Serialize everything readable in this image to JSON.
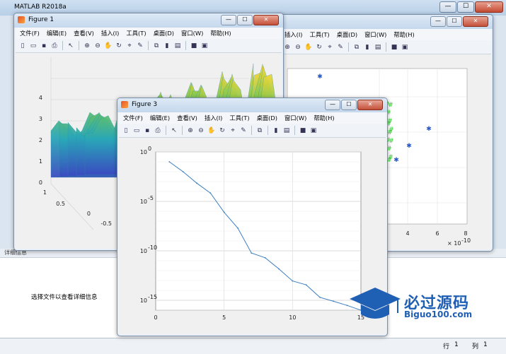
{
  "main_window": {
    "title": "MATLAB R2018a",
    "min": "—",
    "max": "☐",
    "close": "✕",
    "details_label": "详细信息",
    "details_message": "选择文件以查看详细信息",
    "status_row_label": "行",
    "status_row": "1",
    "status_col_label": "列",
    "status_col": "1"
  },
  "menu": [
    "文件(F)",
    "编辑(E)",
    "查看(V)",
    "插入(I)",
    "工具(T)",
    "桌面(D)",
    "窗口(W)",
    "帮助(H)"
  ],
  "figure1": {
    "title": "Figure 1",
    "z_ticks": [
      "4",
      "3",
      "2",
      "1",
      "0"
    ],
    "y_ticks": [
      "1",
      "0.5",
      "0",
      "-0.5"
    ]
  },
  "figure2": {
    "x_ticks": [
      "4",
      "6",
      "8"
    ],
    "x_exponent": "× 10",
    "x_exponent_power": "-10"
  },
  "figure3": {
    "title": "Figure 3",
    "y_tick_labels": [
      "10",
      "10",
      "10",
      "10"
    ],
    "y_tick_powers": [
      "0",
      "-5",
      "-10",
      "-15"
    ],
    "x_tick_labels": [
      "0",
      "5",
      "10",
      "15"
    ]
  },
  "chart_data": {
    "type": "line",
    "title": "",
    "xlabel": "",
    "ylabel": "",
    "y_scale": "log",
    "xlim": [
      0,
      15
    ],
    "ylim": [
      1e-16,
      1
    ],
    "grid": true,
    "x": [
      1,
      2,
      3,
      4,
      5,
      6,
      7,
      8,
      9,
      10,
      11,
      12,
      13,
      14,
      15
    ],
    "series": [
      {
        "values": [
          0.1,
          0.01,
          0.0007,
          7e-05,
          8e-07,
          2e-08,
          6e-11,
          2e-11,
          1.5e-12,
          9e-14,
          3.6e-14,
          2e-15,
          8e-16,
          3e-16,
          1e-16
        ]
      }
    ],
    "color": "#3c7fc1"
  },
  "watermark": {
    "text": "必过源码",
    "url": "Biguo100.com"
  }
}
